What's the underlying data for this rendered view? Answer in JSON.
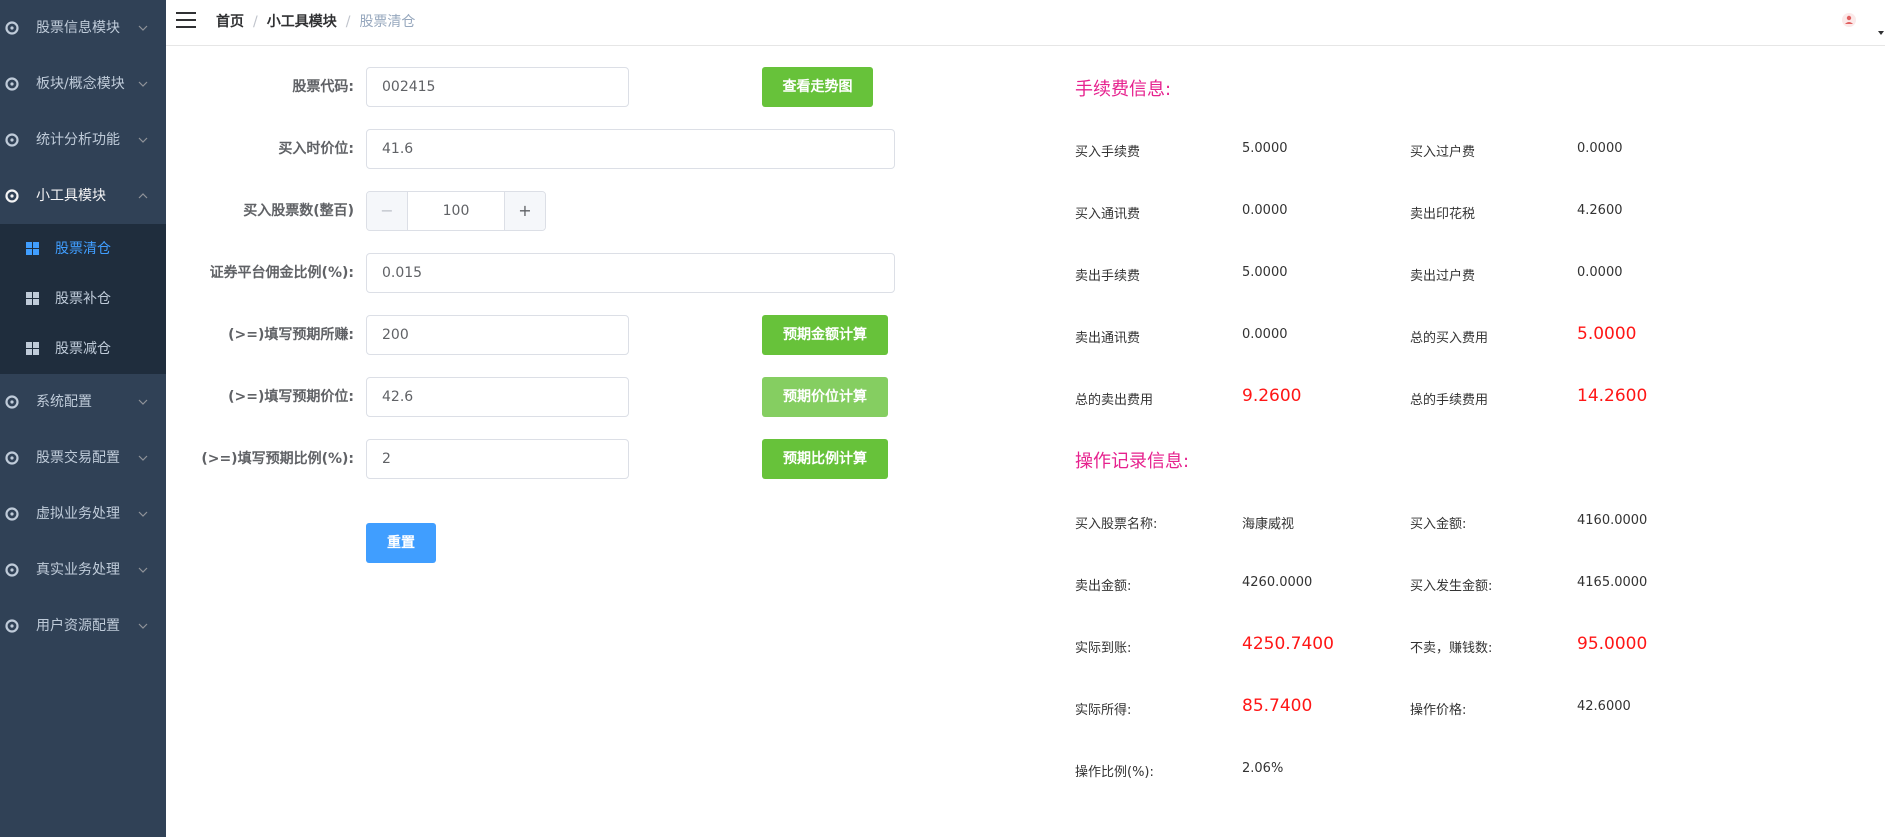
{
  "sidebar": {
    "menus_top": [
      {
        "label": "股票信息模块"
      },
      {
        "label": "板块/概念模块"
      },
      {
        "label": "统计分析功能"
      }
    ],
    "opened_menu": {
      "label": "小工具模块"
    },
    "submenu": [
      {
        "label": "股票清仓",
        "active": true
      },
      {
        "label": "股票补仓",
        "active": false
      },
      {
        "label": "股票减仓",
        "active": false
      }
    ],
    "menus_bottom": [
      {
        "label": "系统配置"
      },
      {
        "label": "股票交易配置"
      },
      {
        "label": "虚拟业务处理"
      },
      {
        "label": "真实业务处理"
      },
      {
        "label": "用户资源配置"
      }
    ]
  },
  "header": {
    "breadcrumb": [
      "首页",
      "小工具模块",
      "股票清仓"
    ],
    "separator": "/"
  },
  "form": {
    "stock_code": {
      "label": "股票代码:",
      "value": "002415"
    },
    "view_trend_button": "查看走势图",
    "buy_price": {
      "label": "买入时价位:",
      "value": "41.6"
    },
    "buy_quantity": {
      "label": "买入股票数(整百)",
      "value": "100",
      "minus": "−",
      "plus": "+"
    },
    "commission_rate": {
      "label": "证券平台佣金比例(%):",
      "value": "0.015"
    },
    "expected_profit": {
      "label": "(>=)填写预期所赚:",
      "value": "200"
    },
    "expected_amount_button": "预期金额计算",
    "expected_price": {
      "label": "(>=)填写预期价位:",
      "value": "42.6"
    },
    "expected_price_button": "预期价位计算",
    "expected_ratio": {
      "label": "(>=)填写预期比例(%):",
      "value": "2"
    },
    "expected_ratio_button": "预期比例计算",
    "reset_button": "重置"
  },
  "fee_info": {
    "title": "手续费信息:",
    "rows": [
      [
        {
          "label": "买入手续费",
          "value": "5.0000",
          "highlight": false
        },
        {
          "label": "买入过户费",
          "value": "0.0000",
          "highlight": false
        }
      ],
      [
        {
          "label": "买入通讯费",
          "value": "0.0000",
          "highlight": false
        },
        {
          "label": "卖出印花税",
          "value": "4.2600",
          "highlight": false
        }
      ],
      [
        {
          "label": "卖出手续费",
          "value": "5.0000",
          "highlight": false
        },
        {
          "label": "卖出过户费",
          "value": "0.0000",
          "highlight": false
        }
      ],
      [
        {
          "label": "卖出通讯费",
          "value": "0.0000",
          "highlight": false
        },
        {
          "label": "总的买入费用",
          "value": "5.0000",
          "highlight": true
        }
      ],
      [
        {
          "label": "总的卖出费用",
          "value": "9.2600",
          "highlight": true
        },
        {
          "label": "总的手续费用",
          "value": "14.2600",
          "highlight": true
        }
      ]
    ]
  },
  "operation_info": {
    "title": "操作记录信息:",
    "rows": [
      [
        {
          "label": "买入股票名称:",
          "value": "海康威视",
          "highlight": false
        },
        {
          "label": "买入金额:",
          "value": "4160.0000",
          "highlight": false
        }
      ],
      [
        {
          "label": "卖出金额:",
          "value": "4260.0000",
          "highlight": false
        },
        {
          "label": "买入发生金额:",
          "value": "4165.0000",
          "highlight": false
        }
      ],
      [
        {
          "label": "实际到账:",
          "value": "4250.7400",
          "highlight": true
        },
        {
          "label": "不卖，赚钱数:",
          "value": "95.0000",
          "highlight": true
        }
      ],
      [
        {
          "label": "实际所得:",
          "value": "85.7400",
          "highlight": true
        },
        {
          "label": "操作价格:",
          "value": "42.6000",
          "highlight": false
        }
      ],
      [
        {
          "label": "操作比例(%):",
          "value": "2.06%",
          "highlight": false
        }
      ]
    ]
  },
  "colors": {
    "sidebar_bg": "#304156",
    "submenu_bg": "#1f2d3d",
    "active_blue": "#409eff",
    "green_button": "#67c23a",
    "section_title": "#e6218e",
    "highlight_red": "#ff1616"
  }
}
